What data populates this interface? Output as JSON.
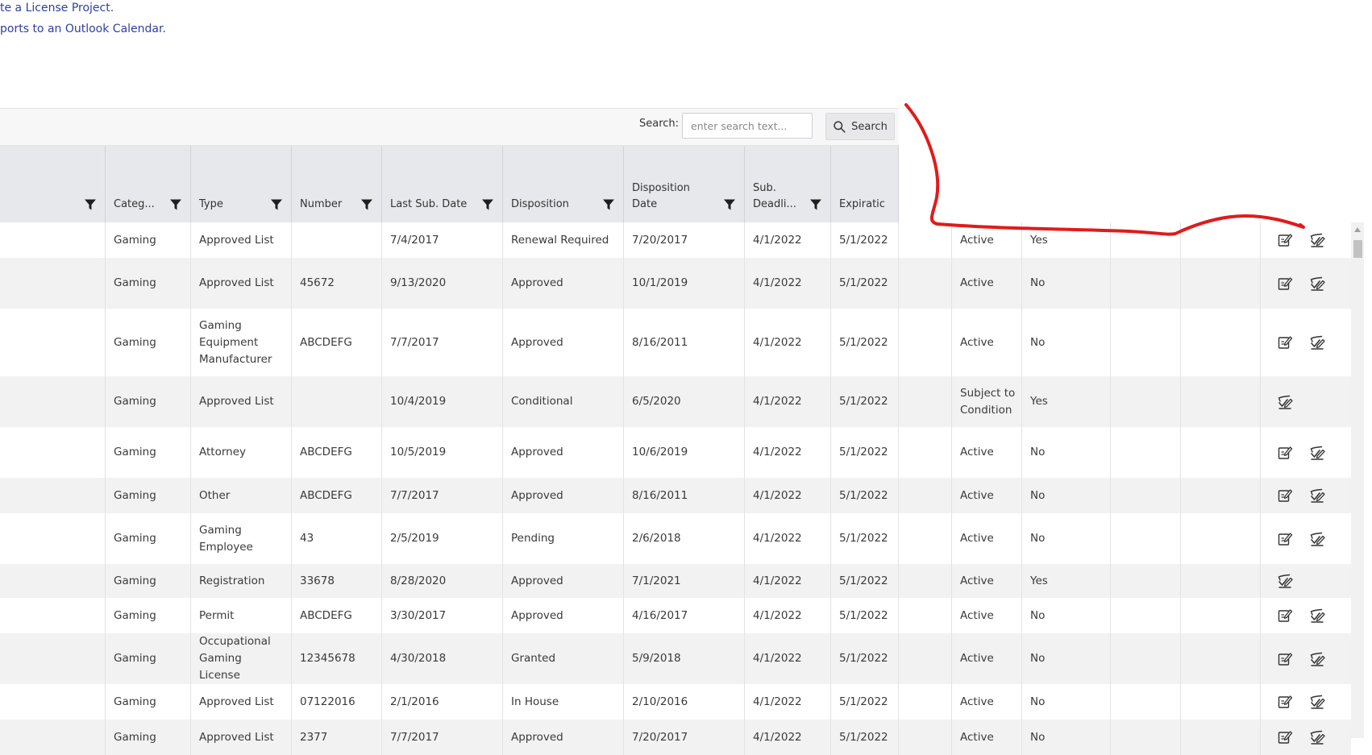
{
  "top_links": [
    "te a License Project.",
    "ports to an Outlook Calendar."
  ],
  "search": {
    "label": "Search:",
    "placeholder": "enter search text...",
    "button_label": "Search"
  },
  "columns": [
    {
      "label": ""
    },
    {
      "label": "Categ..."
    },
    {
      "label": "Type"
    },
    {
      "label": "Number"
    },
    {
      "label": "Last Sub. Date"
    },
    {
      "label": "Disposition"
    },
    {
      "label": "Disposition Date"
    },
    {
      "label": "Sub. Deadli..."
    },
    {
      "label": "Expiratic"
    }
  ],
  "rows": [
    {
      "category": "Gaming",
      "type": "Approved List",
      "number": "",
      "last_sub_date": "7/4/2017",
      "disposition": "Renewal Required",
      "disposition_date": "7/20/2017",
      "sub_deadline": "4/1/2022",
      "expiration": "5/1/2022",
      "status": "Active",
      "flag": "Yes",
      "icons": [
        "edit-icon",
        "edit-check-icon"
      ]
    },
    {
      "category": "Gaming",
      "type": "Approved List",
      "number": "45672",
      "last_sub_date": "9/13/2020",
      "disposition": "Approved",
      "disposition_date": "10/1/2019",
      "sub_deadline": "4/1/2022",
      "expiration": "5/1/2022",
      "status": "Active",
      "flag": "No",
      "icons": [
        "edit-icon",
        "edit-check-icon"
      ]
    },
    {
      "category": "Gaming",
      "type": "Gaming Equipment Manufacturer",
      "number": "ABCDEFG",
      "last_sub_date": "7/7/2017",
      "disposition": "Approved",
      "disposition_date": "8/16/2011",
      "sub_deadline": "4/1/2022",
      "expiration": "5/1/2022",
      "status": "Active",
      "flag": "No",
      "icons": [
        "edit-icon",
        "edit-check-icon"
      ]
    },
    {
      "category": "Gaming",
      "type": "Approved List",
      "number": "",
      "last_sub_date": "10/4/2019",
      "disposition": "Conditional",
      "disposition_date": "6/5/2020",
      "sub_deadline": "4/1/2022",
      "expiration": "5/1/2022",
      "status": "Subject to Condition",
      "flag": "Yes",
      "icons": [
        "edit-check-icon"
      ]
    },
    {
      "category": "Gaming",
      "type": "Attorney",
      "number": "ABCDEFG",
      "last_sub_date": "10/5/2019",
      "disposition": "Approved",
      "disposition_date": "10/6/2019",
      "sub_deadline": "4/1/2022",
      "expiration": "5/1/2022",
      "status": "Active",
      "flag": "No",
      "icons": [
        "edit-icon",
        "edit-check-icon"
      ]
    },
    {
      "category": "Gaming",
      "type": "Other",
      "number": "ABCDEFG",
      "last_sub_date": "7/7/2017",
      "disposition": "Approved",
      "disposition_date": "8/16/2011",
      "sub_deadline": "4/1/2022",
      "expiration": "5/1/2022",
      "status": "Active",
      "flag": "No",
      "icons": [
        "edit-icon",
        "edit-check-icon"
      ]
    },
    {
      "category": "Gaming",
      "type": "Gaming Employee",
      "number": "43",
      "last_sub_date": "2/5/2019",
      "disposition": "Pending",
      "disposition_date": "2/6/2018",
      "sub_deadline": "4/1/2022",
      "expiration": "5/1/2022",
      "status": "Active",
      "flag": "No",
      "icons": [
        "edit-icon",
        "edit-check-icon"
      ]
    },
    {
      "category": "Gaming",
      "type": "Registration",
      "number": "33678",
      "last_sub_date": "8/28/2020",
      "disposition": "Approved",
      "disposition_date": "7/1/2021",
      "sub_deadline": "4/1/2022",
      "expiration": "5/1/2022",
      "status": "Active",
      "flag": "Yes",
      "icons": [
        "edit-check-icon"
      ]
    },
    {
      "category": "Gaming",
      "type": "Permit",
      "number": "ABCDEFG",
      "last_sub_date": "3/30/2017",
      "disposition": "Approved",
      "disposition_date": "4/16/2017",
      "sub_deadline": "4/1/2022",
      "expiration": "5/1/2022",
      "status": "Active",
      "flag": "No",
      "icons": [
        "edit-icon",
        "edit-check-icon"
      ]
    },
    {
      "category": "Gaming",
      "type": "Occupational Gaming License",
      "number": "12345678",
      "last_sub_date": "4/30/2018",
      "disposition": "Granted",
      "disposition_date": "5/9/2018",
      "sub_deadline": "4/1/2022",
      "expiration": "5/1/2022",
      "status": "Active",
      "flag": "No",
      "icons": [
        "edit-icon",
        "edit-check-icon"
      ]
    },
    {
      "category": "Gaming",
      "type": "Approved List",
      "number": "07122016",
      "last_sub_date": "2/1/2016",
      "disposition": "In House",
      "disposition_date": "2/10/2016",
      "sub_deadline": "4/1/2022",
      "expiration": "5/1/2022",
      "status": "Active",
      "flag": "No",
      "icons": [
        "edit-icon",
        "edit-check-icon"
      ]
    },
    {
      "category": "Gaming",
      "type": "Approved List",
      "number": "2377",
      "last_sub_date": "7/7/2017",
      "disposition": "Approved",
      "disposition_date": "7/20/2017",
      "sub_deadline": "4/1/2022",
      "expiration": "5/1/2022",
      "status": "Active",
      "flag": "No",
      "icons": [
        "edit-icon",
        "edit-check-icon"
      ]
    }
  ],
  "colors": {
    "link": "#2f3fa0",
    "header_bg": "#e7e8ec",
    "stripe": "#f2f2f2",
    "annotation": "#e01b1b"
  }
}
